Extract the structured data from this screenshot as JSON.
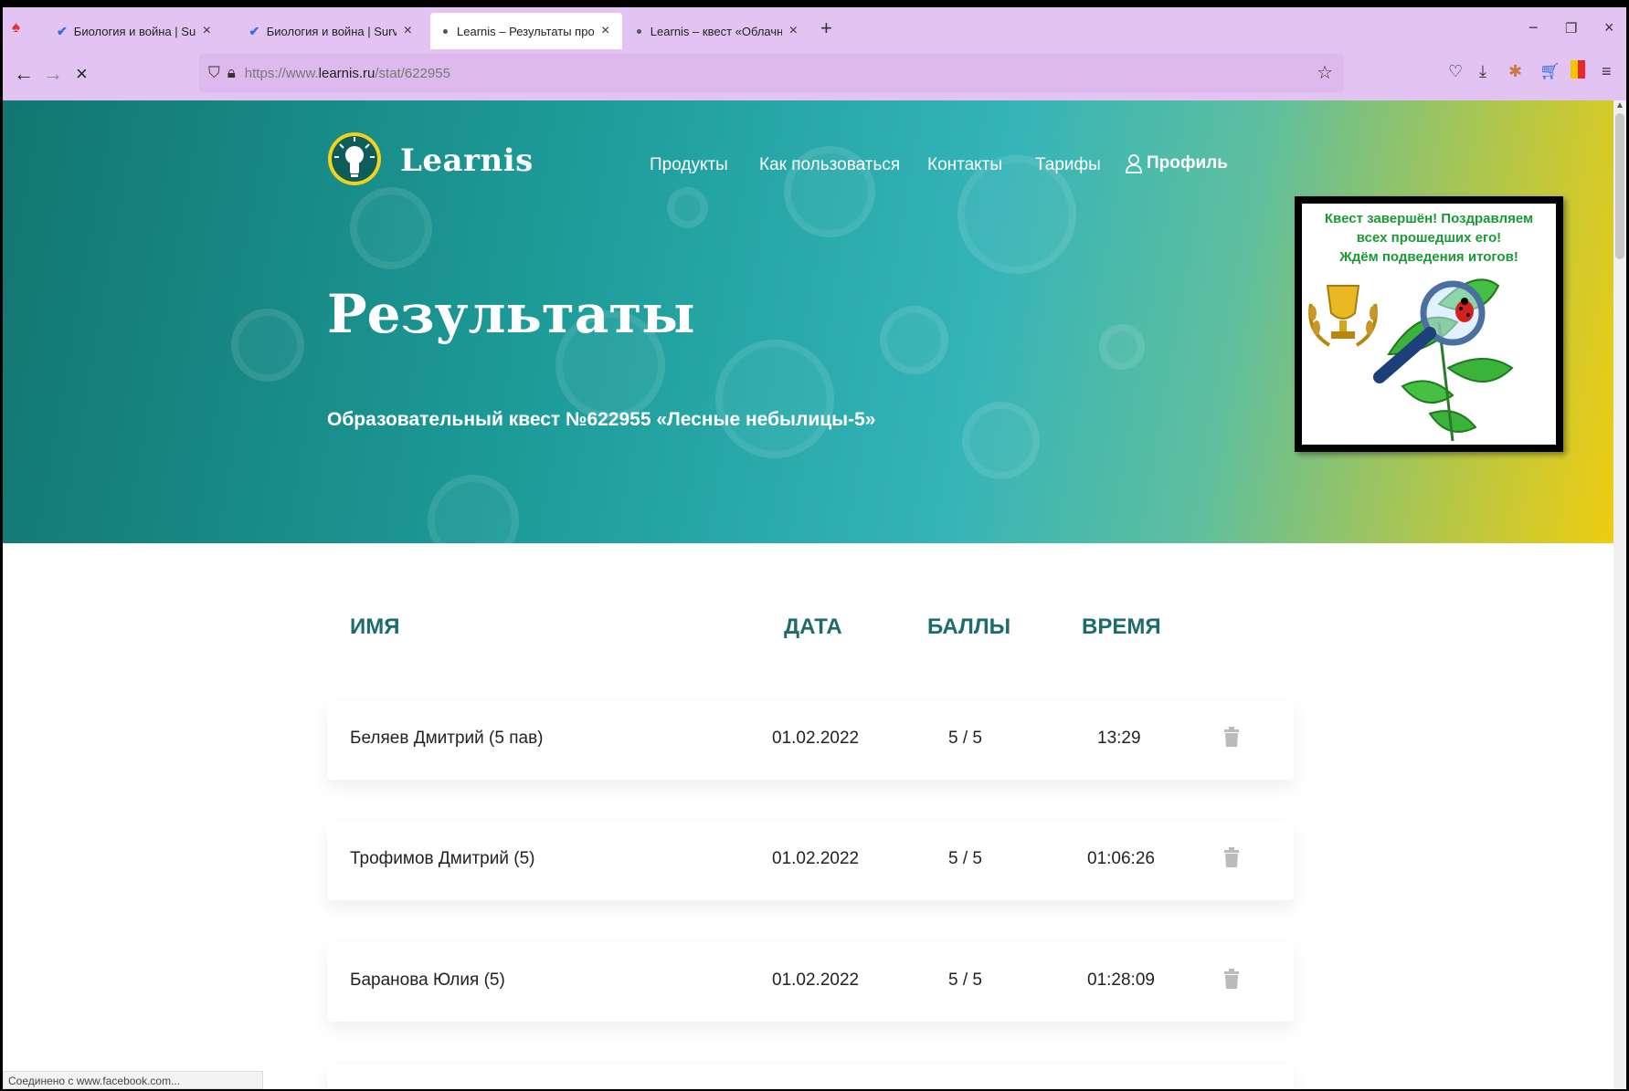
{
  "browser": {
    "tabs": [
      {
        "title": "Биология и война | Survio",
        "icon": "survio-check-icon"
      },
      {
        "title": "Биология и война | Survio",
        "icon": "survio-check-icon"
      },
      {
        "title": "Learnis – Результаты прохожде",
        "icon": "loading-dot"
      },
      {
        "title": "Learnis – квест «Облачная ком",
        "icon": "loading-dot"
      }
    ],
    "url_prefix": "https://www.",
    "url_domain": "learnis.ru",
    "url_path": "/stat/622955"
  },
  "site": {
    "brand": "Learnis",
    "menu": [
      "Продукты",
      "Как пользоваться",
      "Контакты",
      "Тарифы"
    ],
    "profile": "Профиль"
  },
  "hero": {
    "title": "Результаты",
    "subtitle": "Образовательный квест №622955 «Лесные небылицы-5»"
  },
  "banner": {
    "line1": "Квест завершён! Поздравляем",
    "line2": "всех прошедших его!",
    "line3": "Ждём подведения итогов!"
  },
  "table": {
    "headers": {
      "name": "ИМЯ",
      "date": "ДАТА",
      "score": "БАЛЛЫ",
      "time": "ВРЕМЯ"
    },
    "rows": [
      {
        "name": "Беляев Дмитрий (5 пав)",
        "date": "01.02.2022",
        "score": "5 / 5",
        "time": "13:29"
      },
      {
        "name": "Трофимов Дмитрий (5)",
        "date": "01.02.2022",
        "score": "5 / 5",
        "time": "01:06:26"
      },
      {
        "name": "Баранова Юлия (5)",
        "date": "01.02.2022",
        "score": "5 / 5",
        "time": "01:28:09"
      }
    ]
  },
  "status_text": "Соединено с www.facebook.com..."
}
